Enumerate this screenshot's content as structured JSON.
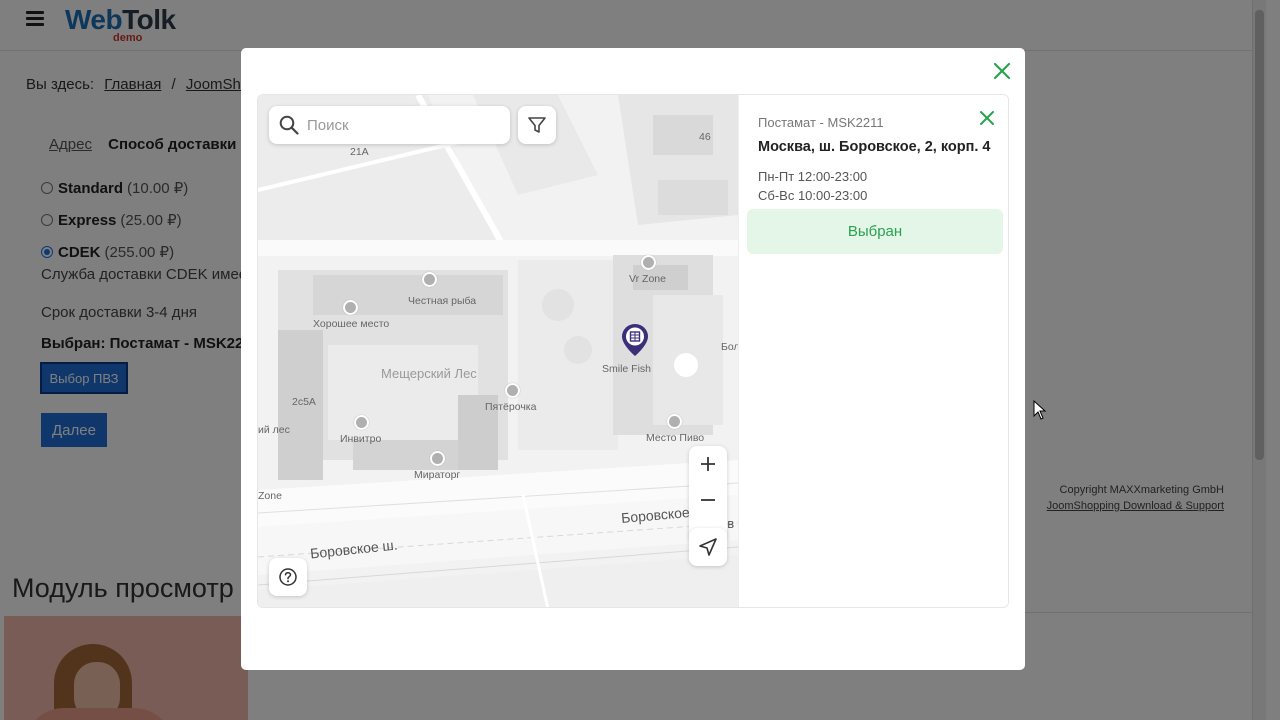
{
  "header": {
    "logo_web": "Web",
    "logo_tolk": "Tolk",
    "logo_sub": "demo"
  },
  "breadcrumb": {
    "prefix": "Вы здесь:",
    "items": [
      "Главная",
      "JoomShopping"
    ],
    "separator": "/"
  },
  "checkout": {
    "tabs": [
      "Адрес",
      "Способ доставки"
    ],
    "shipping": [
      {
        "name": "Standard",
        "price": "(10.00 ₽)",
        "selected": false
      },
      {
        "name": "Express",
        "price": "(25.00 ₽)",
        "selected": false
      },
      {
        "name": "CDEK",
        "price": "(255.00 ₽)",
        "selected": true
      }
    ],
    "cdek_description": "Служба доставки CDEK имее",
    "delivery_term": "Срок доставки 3-4 дня",
    "chosen_label": "Выбран: Постамат - MSK22",
    "pickup_button": "Выбор ПВЗ",
    "next_button": "Далее"
  },
  "footer": {
    "copyright": "Copyright MAXXmarketing GmbH",
    "link": "JoomShopping Download & Support"
  },
  "module": {
    "title": "Модуль просмотр"
  },
  "widget": {
    "search_placeholder": "Поиск",
    "map_labels": {
      "label_21a": "21А",
      "label_46": "46",
      "fish": "Честная рыба",
      "good_place": "Хорошее место",
      "forest": "Мещерский Лес",
      "pyaterochka": "Пятёрочка",
      "invitro": "Инвитро",
      "miratorg": "Мираторг",
      "vr_zone": "Vr Zone",
      "smile_fish": "Smile Fish",
      "mesto_pivo": "Место Пиво",
      "label_2c5a": "2с5А",
      "les_left": "ий лес",
      "zone_left": "Zone",
      "bol_right": "Бол",
      "road_main": "Боровское ш.",
      "road_right1": "Боровское",
      "road_right2": "Боров"
    },
    "selected_point": {
      "id": "Постамат - MSK2211",
      "address": "Москва, ш. Боровское, 2, корп. 4",
      "hours": [
        "Пн-Пт 12:00-23:00",
        "Сб-Вс 10:00-23:00"
      ],
      "status_button": "Выбран"
    }
  },
  "colors": {
    "brand_blue": "#1e6fd9",
    "close_green": "#2aa24f",
    "selected_bg": "#e4f6e8",
    "pin_purple": "#3c2f7a"
  },
  "icons": [
    "hamburger-icon",
    "close-icon",
    "search-icon",
    "filter-icon",
    "zoom-in-icon",
    "zoom-out-icon",
    "locate-icon",
    "help-icon",
    "pickup-pin-icon",
    "cursor-icon"
  ]
}
